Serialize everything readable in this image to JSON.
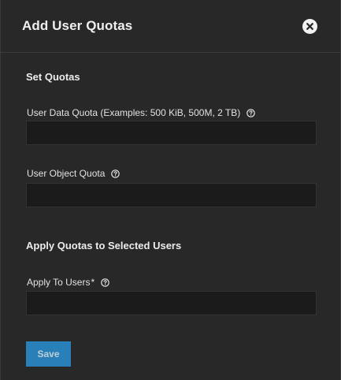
{
  "dialog": {
    "title": "Add User Quotas",
    "close_icon": "close-circle-icon"
  },
  "set_quotas": {
    "section_title": "Set Quotas",
    "data_quota_label": "User Data Quota (Examples: 500 KiB, 500M, 2 TB)",
    "data_quota_value": "",
    "object_quota_label": "User Object Quota",
    "object_quota_value": ""
  },
  "apply_quotas": {
    "section_title": "Apply Quotas to Selected Users",
    "apply_to_users_label": "Apply To Users",
    "required_marker": "*",
    "apply_to_users_value": ""
  },
  "actions": {
    "save_label": "Save",
    "save_enabled": false
  },
  "colors": {
    "background": "#282828",
    "input_background": "#1b1b1b",
    "accent": "#2a8fd1"
  }
}
